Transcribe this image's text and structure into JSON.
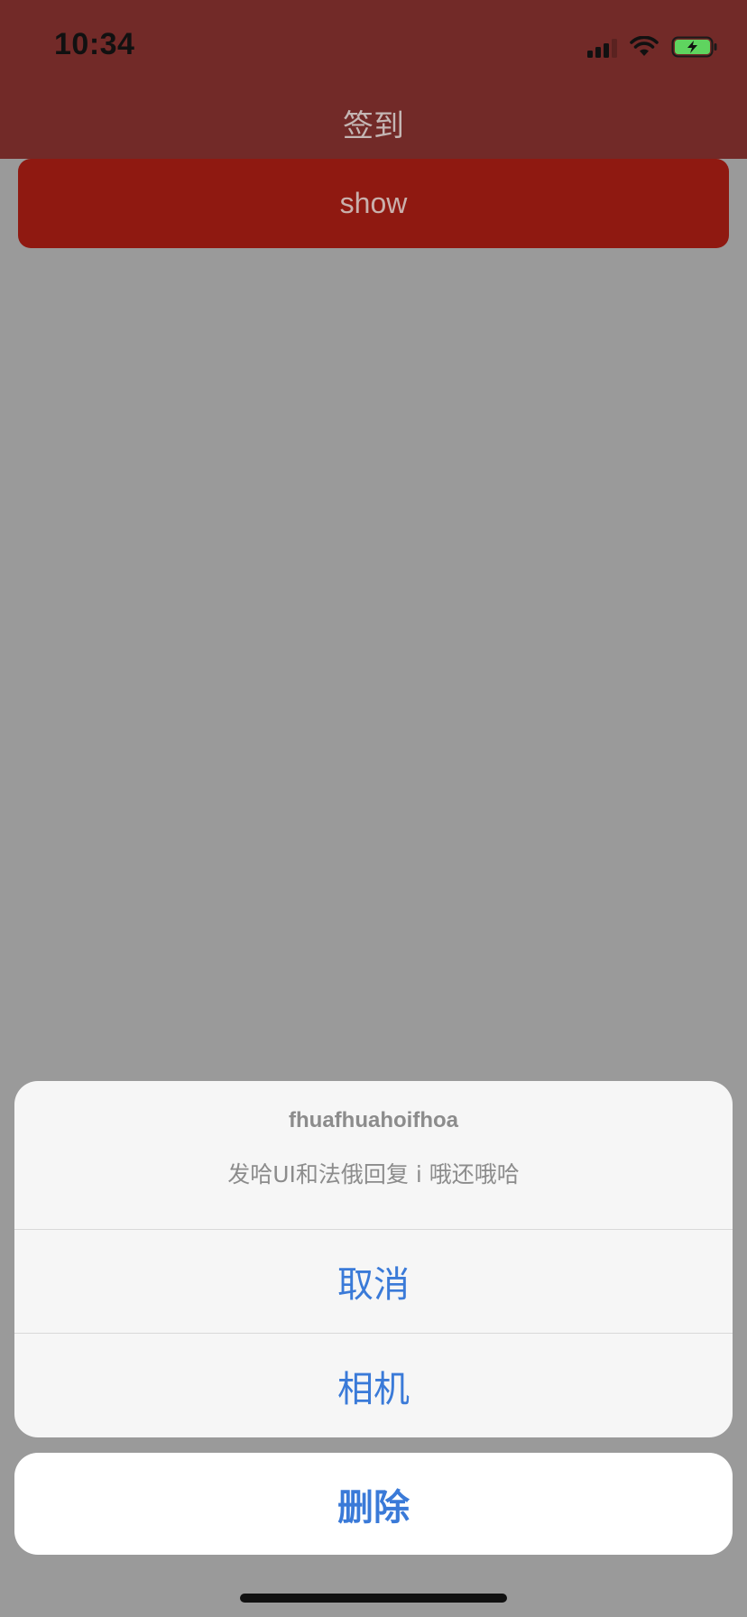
{
  "status_bar": {
    "time": "10:34",
    "signal_icon": "cellular-signal-icon",
    "wifi_icon": "wifi-icon",
    "battery_icon": "battery-charging-icon",
    "background_color": "#722a28"
  },
  "nav_bar": {
    "title": "签到"
  },
  "main": {
    "show_button_label": "show",
    "show_button_color": "#8f1911"
  },
  "action_sheet": {
    "title": "fhuafhuahoifhoa",
    "message": "发哈UI和法俄回复 i 哦还哦哈",
    "actions": [
      {
        "label": "取消"
      },
      {
        "label": "相机"
      }
    ],
    "cancel_label": "删除",
    "action_color": "#3a7ad8"
  }
}
